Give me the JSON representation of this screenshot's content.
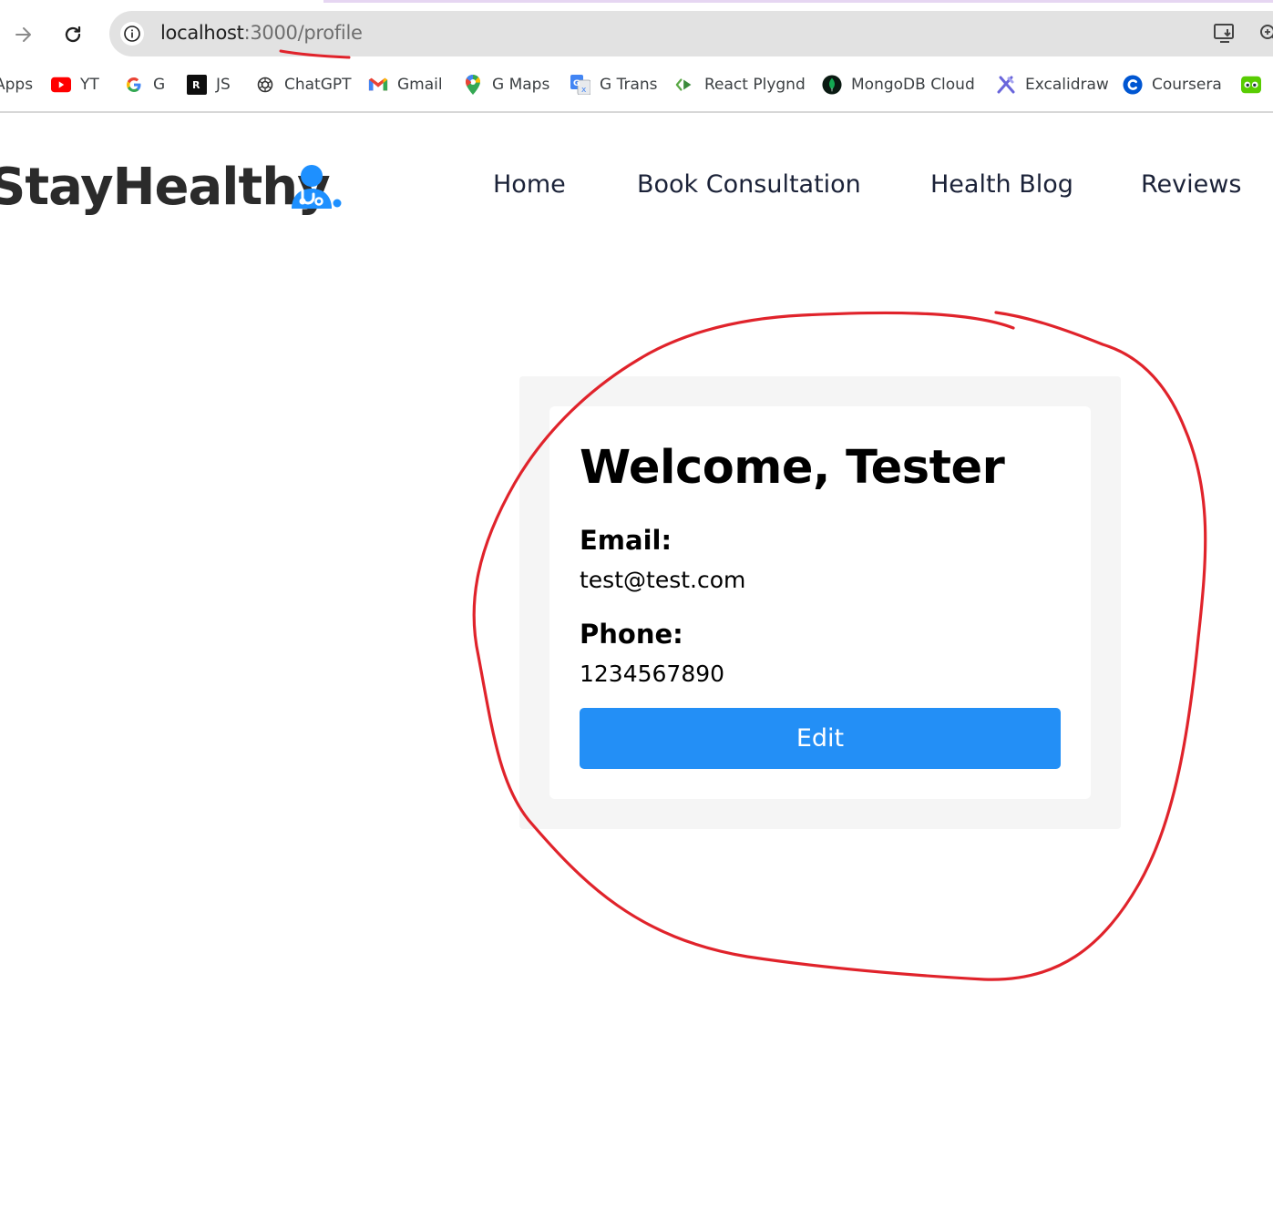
{
  "browser": {
    "url_host": "localhost",
    "url_port_path": ":3000/profile",
    "bookmarks": [
      {
        "label": "Apps",
        "icon": "apps-icon"
      },
      {
        "label": "YT",
        "icon": "youtube-icon"
      },
      {
        "label": "G",
        "icon": "google-icon"
      },
      {
        "label": "JS",
        "icon": "replit-icon"
      },
      {
        "label": "ChatGPT",
        "icon": "chatgpt-icon"
      },
      {
        "label": "Gmail",
        "icon": "gmail-icon"
      },
      {
        "label": "G Maps",
        "icon": "maps-pin-icon"
      },
      {
        "label": "G Trans",
        "icon": "translate-icon"
      },
      {
        "label": "React Plygnd",
        "icon": "react-playground-icon"
      },
      {
        "label": "MongoDB Cloud",
        "icon": "mongodb-icon"
      },
      {
        "label": "Excalidraw",
        "icon": "excalidraw-icon"
      },
      {
        "label": "Coursera",
        "icon": "coursera-icon"
      },
      {
        "label": "",
        "icon": "duolingo-icon"
      }
    ]
  },
  "site": {
    "brand": "StayHealthy",
    "nav": [
      "Home",
      "Book Consultation",
      "Health Blog",
      "Reviews"
    ]
  },
  "profile": {
    "welcome": "Welcome, Tester",
    "email_label": "Email:",
    "email_value": "test@test.com",
    "phone_label": "Phone:",
    "phone_value": "1234567890",
    "edit_label": "Edit"
  },
  "colors": {
    "primary_button": "#238ff6",
    "annotation_red": "#e0232b",
    "card_background": "#f5f5f5"
  }
}
